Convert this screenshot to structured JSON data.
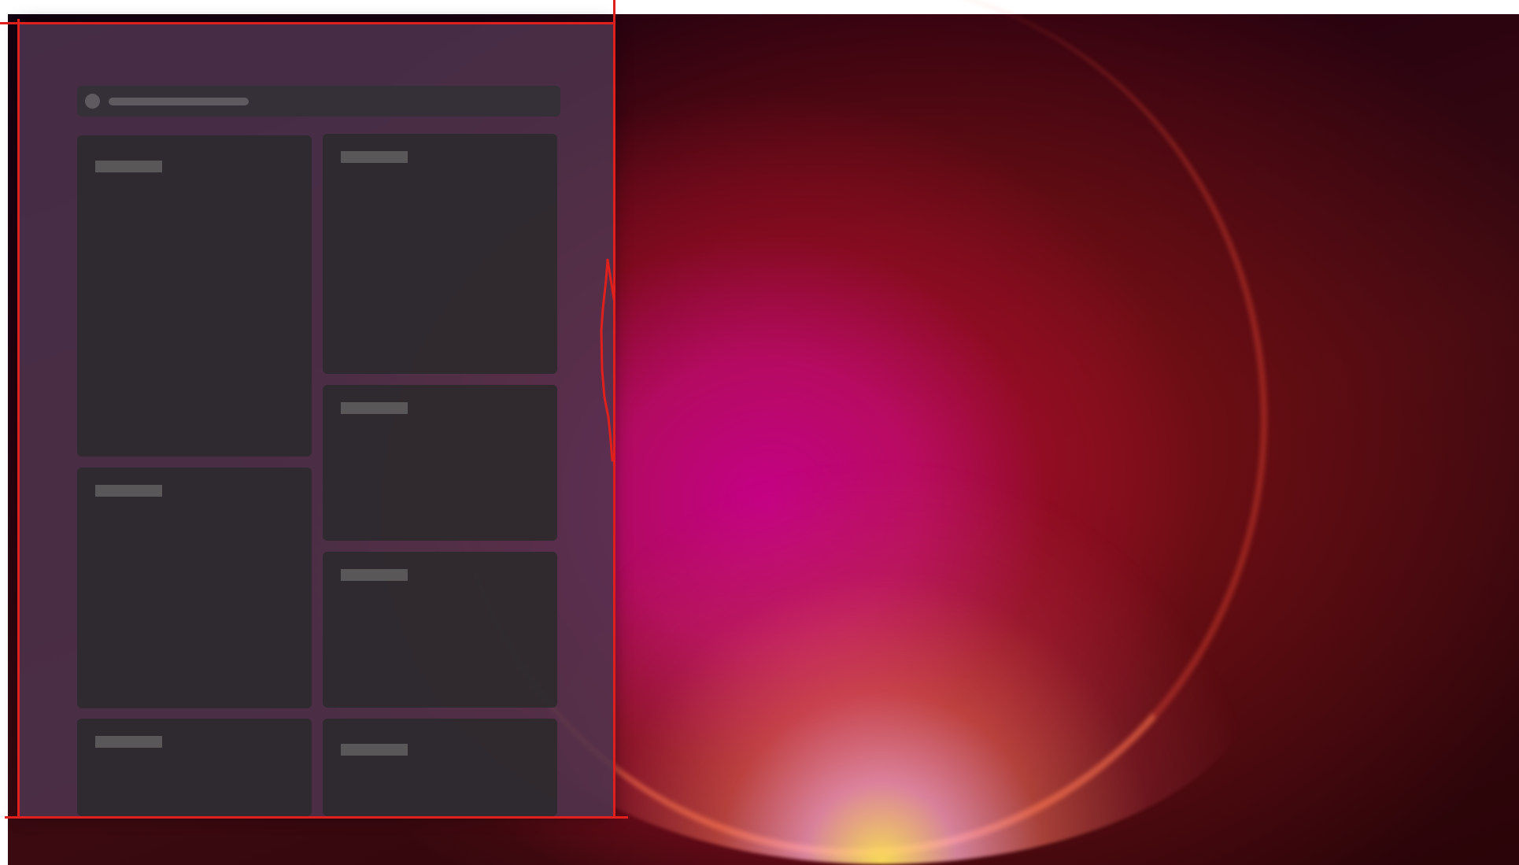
{
  "desktop": {
    "wallpaper": {
      "accent_colors": [
        "#b8007a",
        "#a8101c",
        "#ffe070",
        "#1a000f"
      ]
    }
  },
  "widgets_board": {
    "background_color": "#4e344e",
    "search": {
      "icon": "search-icon",
      "placeholder": ""
    },
    "cards": [
      {
        "id": "left-1",
        "title": ""
      },
      {
        "id": "right-1",
        "title": ""
      },
      {
        "id": "right-2",
        "title": ""
      },
      {
        "id": "left-2",
        "title": ""
      },
      {
        "id": "right-3",
        "title": ""
      },
      {
        "id": "left-3",
        "title": ""
      },
      {
        "id": "right-4",
        "title": ""
      }
    ]
  },
  "annotations": {
    "color": "#e0201c"
  }
}
